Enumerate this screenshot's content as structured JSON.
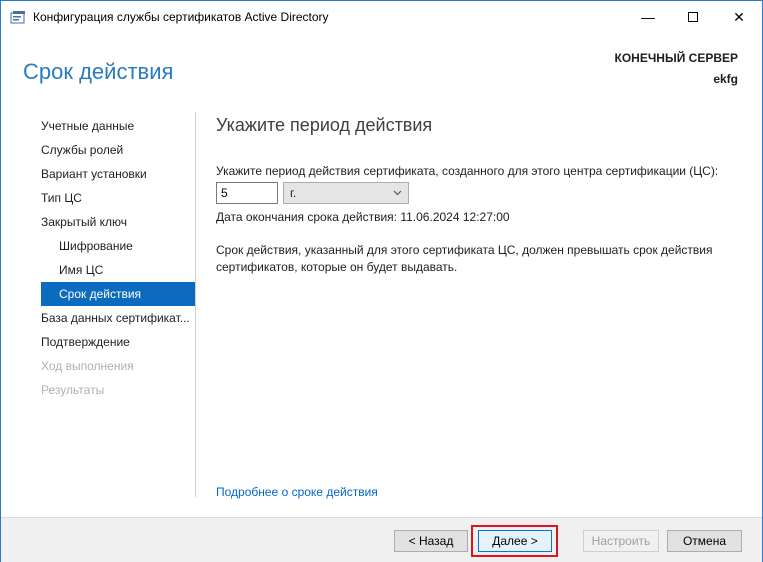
{
  "window": {
    "title": "Конфигурация службы сертификатов Active Directory",
    "minimize_glyph": "—",
    "close_glyph": "✕"
  },
  "header": {
    "page_title": "Срок действия",
    "server_label": "КОНЕЧНЫЙ СЕРВЕР",
    "server_name": "ekfg"
  },
  "nav": {
    "items": [
      {
        "label": "Учетные данные",
        "state": "normal"
      },
      {
        "label": "Службы ролей",
        "state": "normal"
      },
      {
        "label": "Вариант установки",
        "state": "normal"
      },
      {
        "label": "Тип ЦС",
        "state": "normal"
      },
      {
        "label": "Закрытый ключ",
        "state": "normal"
      },
      {
        "label": "Шифрование",
        "state": "sub"
      },
      {
        "label": "Имя ЦС",
        "state": "sub"
      },
      {
        "label": "Срок действия",
        "state": "active"
      },
      {
        "label": "База данных сертификат...",
        "state": "normal"
      },
      {
        "label": "Подтверждение",
        "state": "normal"
      },
      {
        "label": "Ход выполнения",
        "state": "disabled"
      },
      {
        "label": "Результаты",
        "state": "disabled"
      }
    ]
  },
  "content": {
    "title": "Укажите период действия",
    "prompt": "Укажите период действия сертификата, созданного для этого центра сертификации (ЦС):",
    "period_value": "5",
    "period_unit": "г.",
    "expiry": "Дата окончания срока действия: 11.06.2024 12:27:00",
    "note": "Срок действия, указанный для этого сертификата ЦС, должен превышать срок действия сертификатов, которые он будет выдавать.",
    "more_link": "Подробнее о сроке действия"
  },
  "footer": {
    "back": "< Назад",
    "next": "Далее >",
    "configure": "Настроить",
    "cancel": "Отмена"
  },
  "colors": {
    "accent": "#2b7bc1",
    "active_nav": "#0b6cbf",
    "highlight_ring": "#e0141e",
    "link": "#0066cc"
  },
  "icons": [
    "app-certificate-icon",
    "minimize-icon",
    "maximize-icon",
    "close-icon",
    "chevron-down-icon"
  ]
}
